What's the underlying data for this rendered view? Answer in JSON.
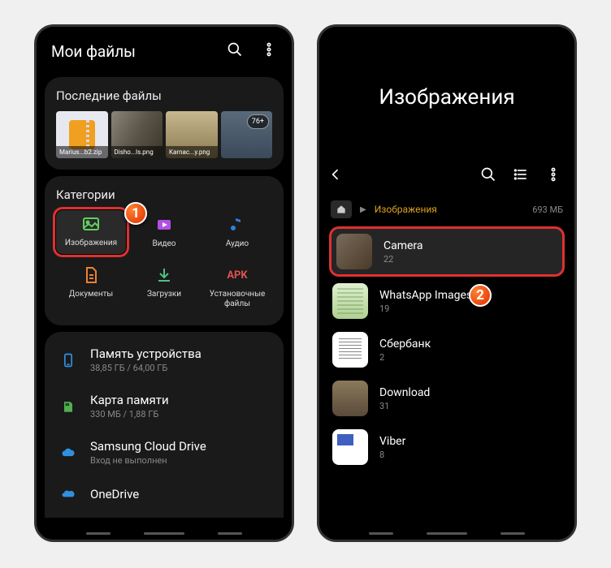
{
  "left": {
    "header": {
      "title": "Мои файлы"
    },
    "recent": {
      "title": "Последние файлы",
      "items": [
        "Marius...b2.zip",
        "Disho...ls.png",
        "Karnac...y.png"
      ],
      "more": "76+"
    },
    "categories": {
      "title": "Категории",
      "items": [
        {
          "label": "Изображения"
        },
        {
          "label": "Видео"
        },
        {
          "label": "Аудио"
        },
        {
          "label": "Документы"
        },
        {
          "label": "Загрузки"
        },
        {
          "label": "Установочные файлы",
          "apk": "APK"
        }
      ]
    },
    "storage": [
      {
        "name": "Память устройства",
        "sub": "38,85 ГБ / 64,00 ГБ"
      },
      {
        "name": "Карта памяти",
        "sub": "330 МБ / 1,88 ГБ"
      },
      {
        "name": "Samsung Cloud Drive",
        "sub": "Вход не выполнен"
      },
      {
        "name": "OneDrive",
        "sub": ""
      }
    ]
  },
  "right": {
    "title": "Изображения",
    "breadcrumb": {
      "current": "Изображения",
      "size": "693 МБ"
    },
    "folders": [
      {
        "name": "Camera",
        "count": "22"
      },
      {
        "name": "WhatsApp Images",
        "count": "19"
      },
      {
        "name": "Сбербанк",
        "count": "2"
      },
      {
        "name": "Download",
        "count": "31"
      },
      {
        "name": "Viber",
        "count": "8"
      }
    ]
  },
  "badges": {
    "one": "1",
    "two": "2"
  }
}
